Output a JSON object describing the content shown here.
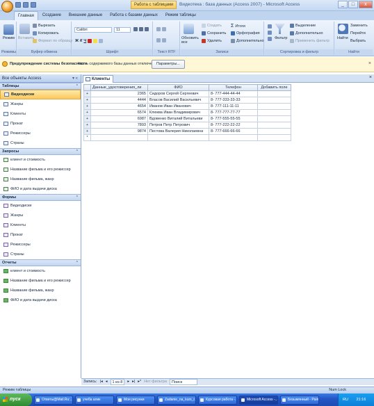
{
  "window": {
    "title": "Видеотека : база данных (Access 2007) - Microsoft Access",
    "context_tab_group": "Работа с таблицами",
    "controls": [
      "_",
      "□",
      "x"
    ]
  },
  "ribbon_tabs": [
    "Главная",
    "Создание",
    "Внешние данные",
    "Работа с базами данных",
    "Режим таблицы"
  ],
  "ribbon": {
    "groups": {
      "views": "Режимы",
      "clipboard": "Буфер обмена",
      "font": "Шрифт",
      "rich_text": "Текст RTF",
      "records": "Записи",
      "sort_filter": "Сортировка и фильтр",
      "find": "Найти"
    },
    "view_label": "Режим",
    "paste_label": "Вставить",
    "cut_label": "Вырезать",
    "copy_label": "Копировать",
    "format_painter_label": "Формат по образцу",
    "font_name": "Calibri",
    "font_size": "11",
    "refresh_label": "Обновить все",
    "new_label": "Создать",
    "save_label": "Сохранить",
    "delete_label": "Удалить",
    "totals_label": "Итоги",
    "spelling_label": "Орфография",
    "more_label": "Дополнительно",
    "filter_label": "Фильтр",
    "selection_label": "Выделение",
    "advanced_label": "Дополнительно",
    "toggle_filter_label": "Применить фильтр",
    "replace_label": "Заменить",
    "goto_label": "Перейти",
    "select_label": "Выбрать",
    "find_label": "Найти"
  },
  "security": {
    "title": "Предупреждение системы безопасности",
    "message": "Часть содержимого базы данных отключено",
    "options_button": "Параметры..."
  },
  "nav": {
    "header": "Все объекты Access",
    "sections": [
      {
        "title": "Таблицы",
        "type": "table",
        "items": [
          "Видеодиски",
          "Жанры",
          "Клиенты",
          "Прокат",
          "Режиссеры",
          "Страны"
        ]
      },
      {
        "title": "Запросы",
        "type": "query",
        "items": [
          "клиент и стоимость",
          "Название фильма и его режиссер",
          "Название фильма, жанр",
          "ФИО и дата выдачи диска"
        ]
      },
      {
        "title": "Формы",
        "type": "form",
        "items": [
          "Видеодиски",
          "Жанры",
          "Клиенты",
          "Прокат",
          "Режиссеры",
          "Страны"
        ]
      },
      {
        "title": "Отчеты",
        "type": "report",
        "items": [
          "клиент и стоимость",
          "Название фильма и его режиссер",
          "Название фильма, жанр",
          "ФИО и дата выдачи диска"
        ]
      }
    ]
  },
  "document": {
    "tab_label": "Клиенты",
    "columns": [
      "Данные_удостоверения_ли",
      "ФИО",
      "Телефон",
      "Добавить поле"
    ],
    "rows": [
      [
        "2365",
        "Сидоров Сергей Сергеевич",
        "8- 777-444-44-44"
      ],
      [
        "4444",
        "Власов Василий Васильевич",
        "8- 777-333-33-33"
      ],
      [
        "4654",
        "Иванов Иван Иванович",
        "8- 777-111-11-11"
      ],
      [
        "6574",
        "Клюква Иван Владимирович",
        "8- 777-777-77-77"
      ],
      [
        "6987",
        "Вдовенко Виталий Витальеви",
        "8- 777-555-55-55"
      ],
      [
        "7893",
        "Петров Петр Петрович",
        "8- 777-222-22-22"
      ],
      [
        "9874",
        "Пестова Валерия Николаевна",
        "8- 777-666-66-66"
      ]
    ],
    "expand_marker": "+",
    "new_row_marker": "*"
  },
  "record_nav": {
    "label": "Запись:",
    "position": "1 из 8",
    "filter_status": "Нет фильтра",
    "search_label": "Поиск"
  },
  "status": {
    "mode": "Режим таблицы",
    "numlock": "Num Lock"
  },
  "taskbar": {
    "start": "пуск",
    "buttons": [
      "Ответы@Mail.Ru:...",
      "учеба алик",
      "Мои рисунки",
      "Zadanie_na_kurs_r...",
      "Курсовая работа -...",
      "Microsoft Access -...",
      "Безымянный - Paint"
    ],
    "active_index": 5,
    "lang": "RU",
    "clock": "21:16"
  },
  "colors": {
    "accent": "#c4d8f1",
    "selected_nav": "#fcc95a",
    "taskbar": "#2456c7",
    "start_button": "#2f8b2f"
  }
}
